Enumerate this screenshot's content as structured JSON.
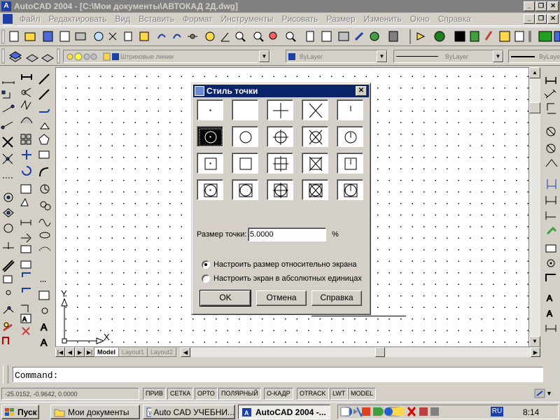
{
  "window": {
    "title": "AutoCAD 2004 - [C:\\Мои документы\\АВТОКАД 2Д.dwg]"
  },
  "menu": [
    "Файл",
    "Редактировать",
    "Вид",
    "Вставить",
    "Формат",
    "Инструменты",
    "Рисовать",
    "Размер",
    "Изменить",
    "Окно",
    "Справка"
  ],
  "properties": {
    "layer": "Штриховые линии",
    "color": "ByLayer",
    "linetype": "ByLayer",
    "lineweight": "ByLayer"
  },
  "dialog": {
    "title": "Стиль точки",
    "size_label": "Размер точки:",
    "size_value": "5.0000",
    "size_unit": "%",
    "radio_relative": "Настроить размер относительно экрана",
    "radio_absolute": "Настроить экран в абсолютных единицах",
    "selected_option": "relative",
    "selected_style": 5,
    "ok": "OK",
    "cancel": "Отмена",
    "help": "Справка"
  },
  "ucs": {
    "x_label": "X",
    "y_label": "Y"
  },
  "layout_tabs": [
    "Model",
    "Layout1",
    "Layout2"
  ],
  "command": {
    "prompt": "Command:"
  },
  "status": {
    "coords": "-25.0152, -0.9642, 0.0000",
    "buttons": [
      "ПРИВ",
      "СЕТКА",
      "ОРТО",
      "ПОЛЯРНЫЙ",
      "О-КАДР",
      "OTRACK",
      "LWT",
      "MODEL"
    ]
  },
  "taskbar": {
    "start": "Пуск",
    "tasks": [
      "Мои документы",
      "Auto CAD УЧЕБНИ...",
      "AutoCAD 2004 -..."
    ],
    "lang": "RU",
    "clock": "8:14"
  },
  "colors": {
    "title_inactive": "#808080",
    "dialog_title": "#0a246a",
    "face": "#d4d0c8",
    "accent_blue": "#1c3fa8"
  }
}
